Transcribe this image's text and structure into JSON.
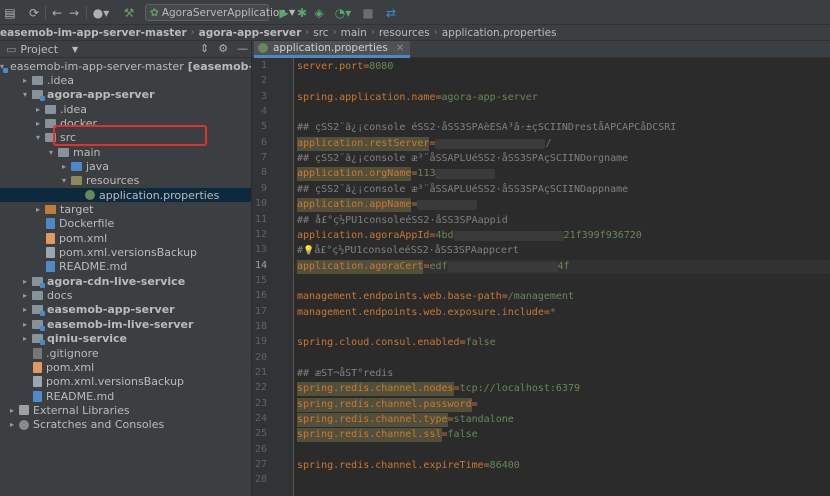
{
  "toolbar": {
    "run_config": "AgoraServerApplication",
    "icons": [
      "save-icon",
      "sync-icon",
      "back-icon",
      "forward-icon",
      "user-icon",
      "build-hammer-icon",
      "spring-icon",
      "run-icon",
      "debug-icon",
      "coverage-icon",
      "profile-icon",
      "stop-icon",
      "translate-icon"
    ]
  },
  "breadcrumb": [
    "easemob-im-app-server-master",
    "agora-app-server",
    "src",
    "main",
    "resources",
    "application.properties"
  ],
  "project_panel": {
    "title": "Project"
  },
  "tree": [
    {
      "label": "easemob-im-app-server-master",
      "extra": "[easemob-im-ap",
      "icon": "module",
      "arrow": "▾",
      "indent": 0,
      "bold": false
    },
    {
      "label": ".idea",
      "icon": "folder",
      "arrow": "▸",
      "indent": 1,
      "bold": false
    },
    {
      "label": "agora-app-server",
      "icon": "module",
      "arrow": "▾",
      "indent": 1,
      "bold": true
    },
    {
      "label": ".idea",
      "icon": "folder",
      "arrow": "▸",
      "indent": 2,
      "bold": false
    },
    {
      "label": "docker",
      "icon": "folder",
      "arrow": "▸",
      "indent": 2,
      "bold": false
    },
    {
      "label": "src",
      "icon": "folder",
      "arrow": "▾",
      "indent": 2,
      "bold": false
    },
    {
      "label": "main",
      "icon": "folder",
      "arrow": "▾",
      "indent": 3,
      "bold": false
    },
    {
      "label": "java",
      "icon": "src",
      "arrow": "▸",
      "indent": 4,
      "bold": false
    },
    {
      "label": "resources",
      "icon": "res",
      "arrow": "▾",
      "indent": 4,
      "bold": false
    },
    {
      "label": "application.properties",
      "icon": "props",
      "arrow": "",
      "indent": 5,
      "bold": false,
      "selected": true
    },
    {
      "label": "target",
      "icon": "target",
      "arrow": "▸",
      "indent": 2,
      "bold": false
    },
    {
      "label": "Dockerfile",
      "icon": "docker",
      "arrow": "",
      "indent": 2,
      "bold": false
    },
    {
      "label": "pom.xml",
      "icon": "xml",
      "arrow": "",
      "indent": 2,
      "bold": false
    },
    {
      "label": "pom.xml.versionsBackup",
      "icon": "file",
      "arrow": "",
      "indent": 2,
      "bold": false
    },
    {
      "label": "README.md",
      "icon": "md",
      "arrow": "",
      "indent": 2,
      "bold": false
    },
    {
      "label": "agora-cdn-live-service",
      "icon": "module",
      "arrow": "▸",
      "indent": 1,
      "bold": true
    },
    {
      "label": "docs",
      "icon": "folder",
      "arrow": "▸",
      "indent": 1,
      "bold": false
    },
    {
      "label": "easemob-app-server",
      "icon": "module",
      "arrow": "▸",
      "indent": 1,
      "bold": true
    },
    {
      "label": "easemob-im-live-server",
      "icon": "module",
      "arrow": "▸",
      "indent": 1,
      "bold": true
    },
    {
      "label": "qiniu-service",
      "icon": "module",
      "arrow": "▸",
      "indent": 1,
      "bold": true
    },
    {
      "label": ".gitignore",
      "icon": "git",
      "arrow": "",
      "indent": 1,
      "bold": false
    },
    {
      "label": "pom.xml",
      "icon": "xml",
      "arrow": "",
      "indent": 1,
      "bold": false
    },
    {
      "label": "pom.xml.versionsBackup",
      "icon": "file",
      "arrow": "",
      "indent": 1,
      "bold": false
    },
    {
      "label": "README.md",
      "icon": "md",
      "arrow": "",
      "indent": 1,
      "bold": false
    },
    {
      "label": "External Libraries",
      "icon": "lib",
      "arrow": "▸",
      "indent": 0,
      "bold": false
    },
    {
      "label": "Scratches and Consoles",
      "icon": "scratch",
      "arrow": "▸",
      "indent": 0,
      "bold": false
    }
  ],
  "editor": {
    "tab_label": "application.properties",
    "current_line": 14,
    "line_numbers": [
      "1",
      "2",
      "3",
      "4",
      "5",
      "6",
      "7",
      "8",
      "9",
      "10",
      "11",
      "12",
      "13",
      "14",
      "15",
      "16",
      "17",
      "18",
      "19",
      "20",
      "21",
      "22",
      "23",
      "24",
      "25",
      "26",
      "27",
      "28"
    ],
    "lines": [
      {
        "n": "1",
        "key": "server.port",
        "val": "8080"
      },
      {
        "n": "2"
      },
      {
        "n": "3",
        "key": "spring.application.name",
        "val": "agora-app-server"
      },
      {
        "n": "4"
      },
      {
        "n": "5",
        "comment": "## çSS2¨ã¿¡console éSS2·åSS3SPAèESA³â·±çSCIINDreståAPCAPCåDCSRI"
      },
      {
        "n": "6",
        "key": "application.restServer",
        "val": "",
        "hl": true,
        "blurred": true,
        "tail": "/"
      },
      {
        "n": "7",
        "comment": "## çSS2¨ã¿¡console æ³¨åSSAPLUéSS2·åSS3SPAçSCIINDorgname"
      },
      {
        "n": "8",
        "key": "application.orgName",
        "val": "113",
        "hl": true,
        "blurred": true
      },
      {
        "n": "9",
        "comment": "## çSS2¨ã¿¡console æ³¨åSSAPLUéSS2·åSS3SPAçSCIINDappname"
      },
      {
        "n": "10",
        "key": "application.appName",
        "val": "",
        "hl": true,
        "blurred": true
      },
      {
        "n": "11",
        "comment": "## å£°ç½PU1consoleéSS2·åSS3SPAappid"
      },
      {
        "n": "12",
        "key": "application.agoraAppId",
        "val": "4bd",
        "hl": false,
        "blurred": true,
        "tail": "21f399f936720"
      },
      {
        "n": "13",
        "comment": "å£°ç½PU1consoleéSS2·åSS3SPAappcert",
        "bulb": true
      },
      {
        "n": "14",
        "key": "application.agoraCert",
        "val": "edf",
        "hl": true,
        "blurred": true,
        "tail": "4f"
      },
      {
        "n": "15"
      },
      {
        "n": "16",
        "key": "management.endpoints.web.base-path",
        "val": "/management"
      },
      {
        "n": "17",
        "key": "management.endpoints.web.exposure.include",
        "val": "*"
      },
      {
        "n": "18"
      },
      {
        "n": "19",
        "key": "spring.cloud.consul.enabled",
        "val": "false"
      },
      {
        "n": "20"
      },
      {
        "n": "21",
        "comment": "## æST¬åST°redis"
      },
      {
        "n": "22",
        "key": "spring.redis.channel.nodes",
        "val": "tcp://localhost:6379",
        "hl": true
      },
      {
        "n": "23",
        "key": "spring.redis.channel.password",
        "val": "",
        "hl": true
      },
      {
        "n": "24",
        "key": "spring.redis.channel.type",
        "val": "standalone",
        "hl": true
      },
      {
        "n": "25",
        "key": "spring.redis.channel.ssl",
        "val": "false",
        "hl": true
      },
      {
        "n": "26"
      },
      {
        "n": "27",
        "key": "spring.redis.channel.expireTime",
        "val": "86400"
      },
      {
        "n": "28"
      }
    ]
  }
}
